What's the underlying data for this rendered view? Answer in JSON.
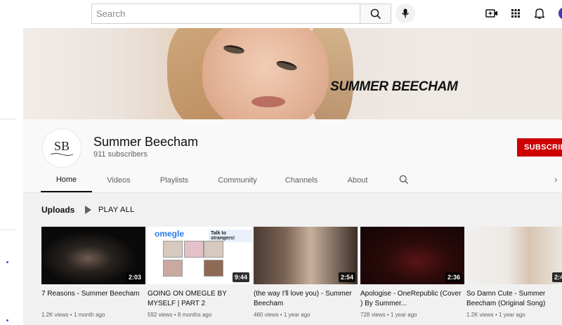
{
  "header": {
    "search_placeholder": "Search",
    "icons": [
      "search-icon",
      "mic-icon",
      "create-video-icon",
      "apps-grid-icon",
      "bell-icon",
      "account-avatar"
    ]
  },
  "banner": {
    "name_text": "SUMMER BEECHAM"
  },
  "channel": {
    "logo_text": "SB",
    "name": "Summer Beecham",
    "subscribers": "911 subscribers",
    "subscribe_label": "SUBSCRIBE"
  },
  "tabs": [
    {
      "label": "Home",
      "active": true
    },
    {
      "label": "Videos"
    },
    {
      "label": "Playlists"
    },
    {
      "label": "Community"
    },
    {
      "label": "Channels"
    },
    {
      "label": "About"
    }
  ],
  "uploads": {
    "heading": "Uploads",
    "play_all": "PLAY ALL",
    "videos": [
      {
        "title": "7 Reasons - Summer Beecham",
        "duration": "2:03",
        "views": "1.2K views",
        "age": "1 month ago"
      },
      {
        "title": "GOING ON OMEGLE BY MYSELF | PART 2",
        "duration": "9:44",
        "views": "592 views",
        "age": "8 months ago",
        "thumb_logo": "omegle",
        "thumb_tag": "Talk to strangers!"
      },
      {
        "title": "(the way I'll love you) - Summer Beecham",
        "duration": "2:54",
        "views": "460 views",
        "age": "1 year ago"
      },
      {
        "title": "Apologise - OneRepublic (Cover ) By Summer...",
        "duration": "2:36",
        "views": "728 views",
        "age": "1 year ago"
      },
      {
        "title": "So Damn Cute - Summer Beecham (Original Song)",
        "duration": "2:4",
        "views": "1.2K views",
        "age": "1 year ago"
      }
    ]
  },
  "colors": {
    "subscribe": "#cc0000",
    "page_bg": "#f9f9f9",
    "content_bg": "#f1f1f1"
  }
}
